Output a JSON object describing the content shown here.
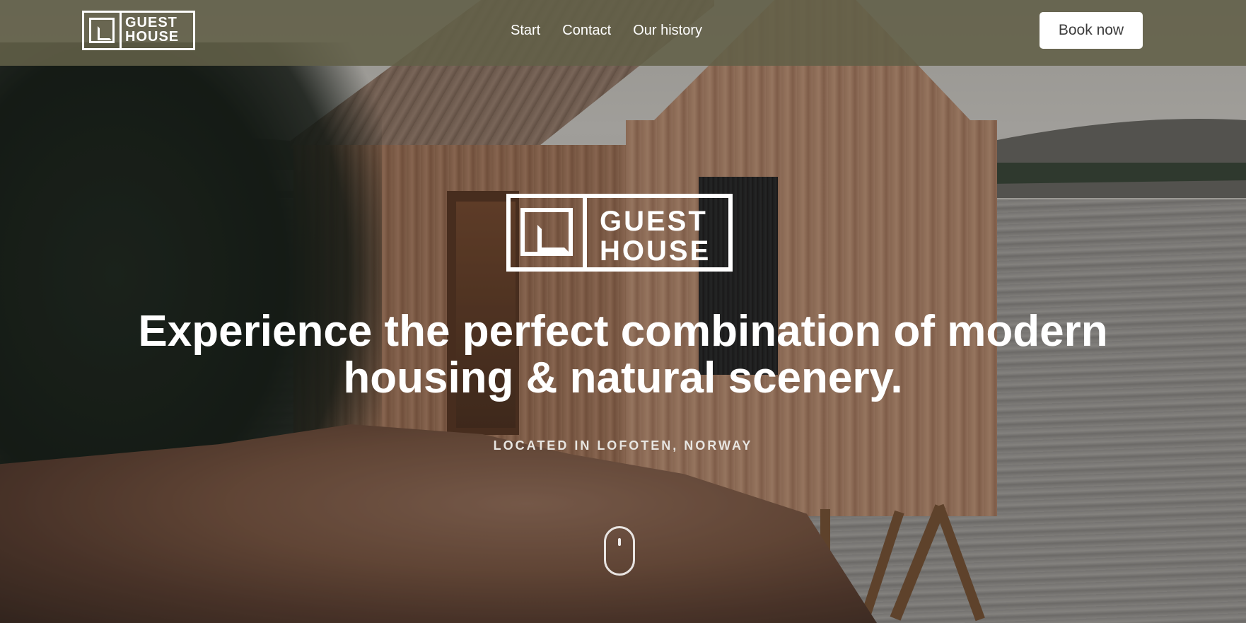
{
  "brand": {
    "logo_line1": "GUEST",
    "logo_line2": "HOUSE"
  },
  "nav": {
    "items": [
      {
        "label": "Start"
      },
      {
        "label": "Contact"
      },
      {
        "label": "Our history"
      }
    ]
  },
  "header": {
    "cta_label": "Book now"
  },
  "hero": {
    "headline": "Experience the perfect combination of modern housing & natural scenery.",
    "subheadline": "LOCATED IN LOFOTEN, NORWAY",
    "scroll_indicator_icon": "mouse-scroll-icon"
  },
  "colors": {
    "header_bg": "#626048",
    "button_bg": "#ffffff",
    "button_text": "#3c3c3c",
    "text": "#ffffff"
  }
}
